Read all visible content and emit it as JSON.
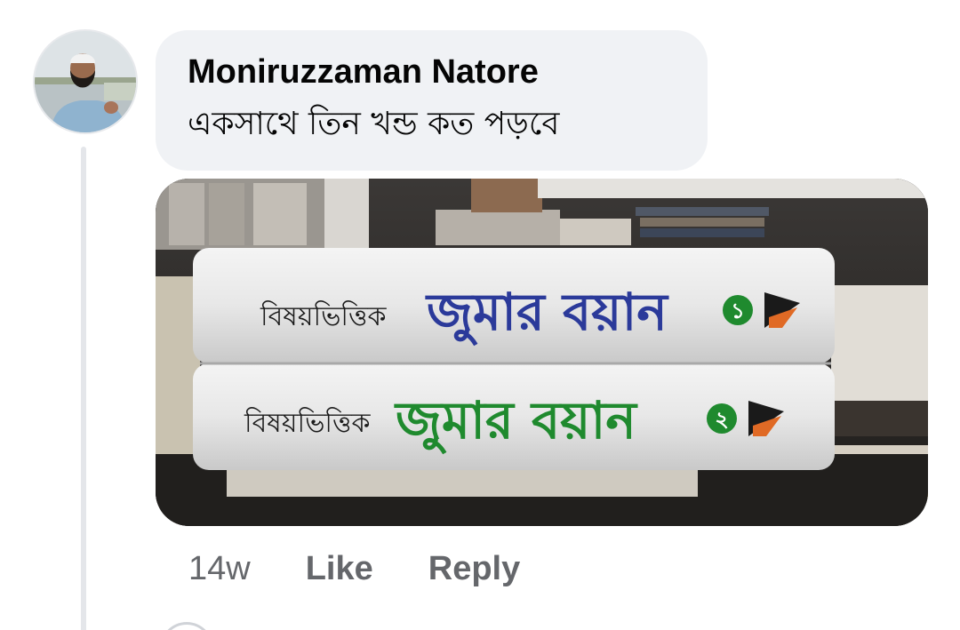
{
  "comment": {
    "author": "Moniruzzaman Natore",
    "text": "একসাথে তিন খন্ড কত পড়বে",
    "timestamp": "14w",
    "like_label": "Like",
    "reply_label": "Reply"
  },
  "photo": {
    "book_top": {
      "prefix": "বিষয়ভিত্তিক",
      "title": "জুমার বয়ান",
      "volume": "১",
      "title_color": "#2b3a9a"
    },
    "book_bottom": {
      "prefix": "বিষয়ভিত্তিক",
      "title": "জুমার বয়ান",
      "volume": "২",
      "title_color": "#1f8a2e"
    }
  },
  "colors": {
    "bubble_bg": "#f0f2f5",
    "text_primary": "#050505",
    "text_secondary": "#65676b"
  }
}
